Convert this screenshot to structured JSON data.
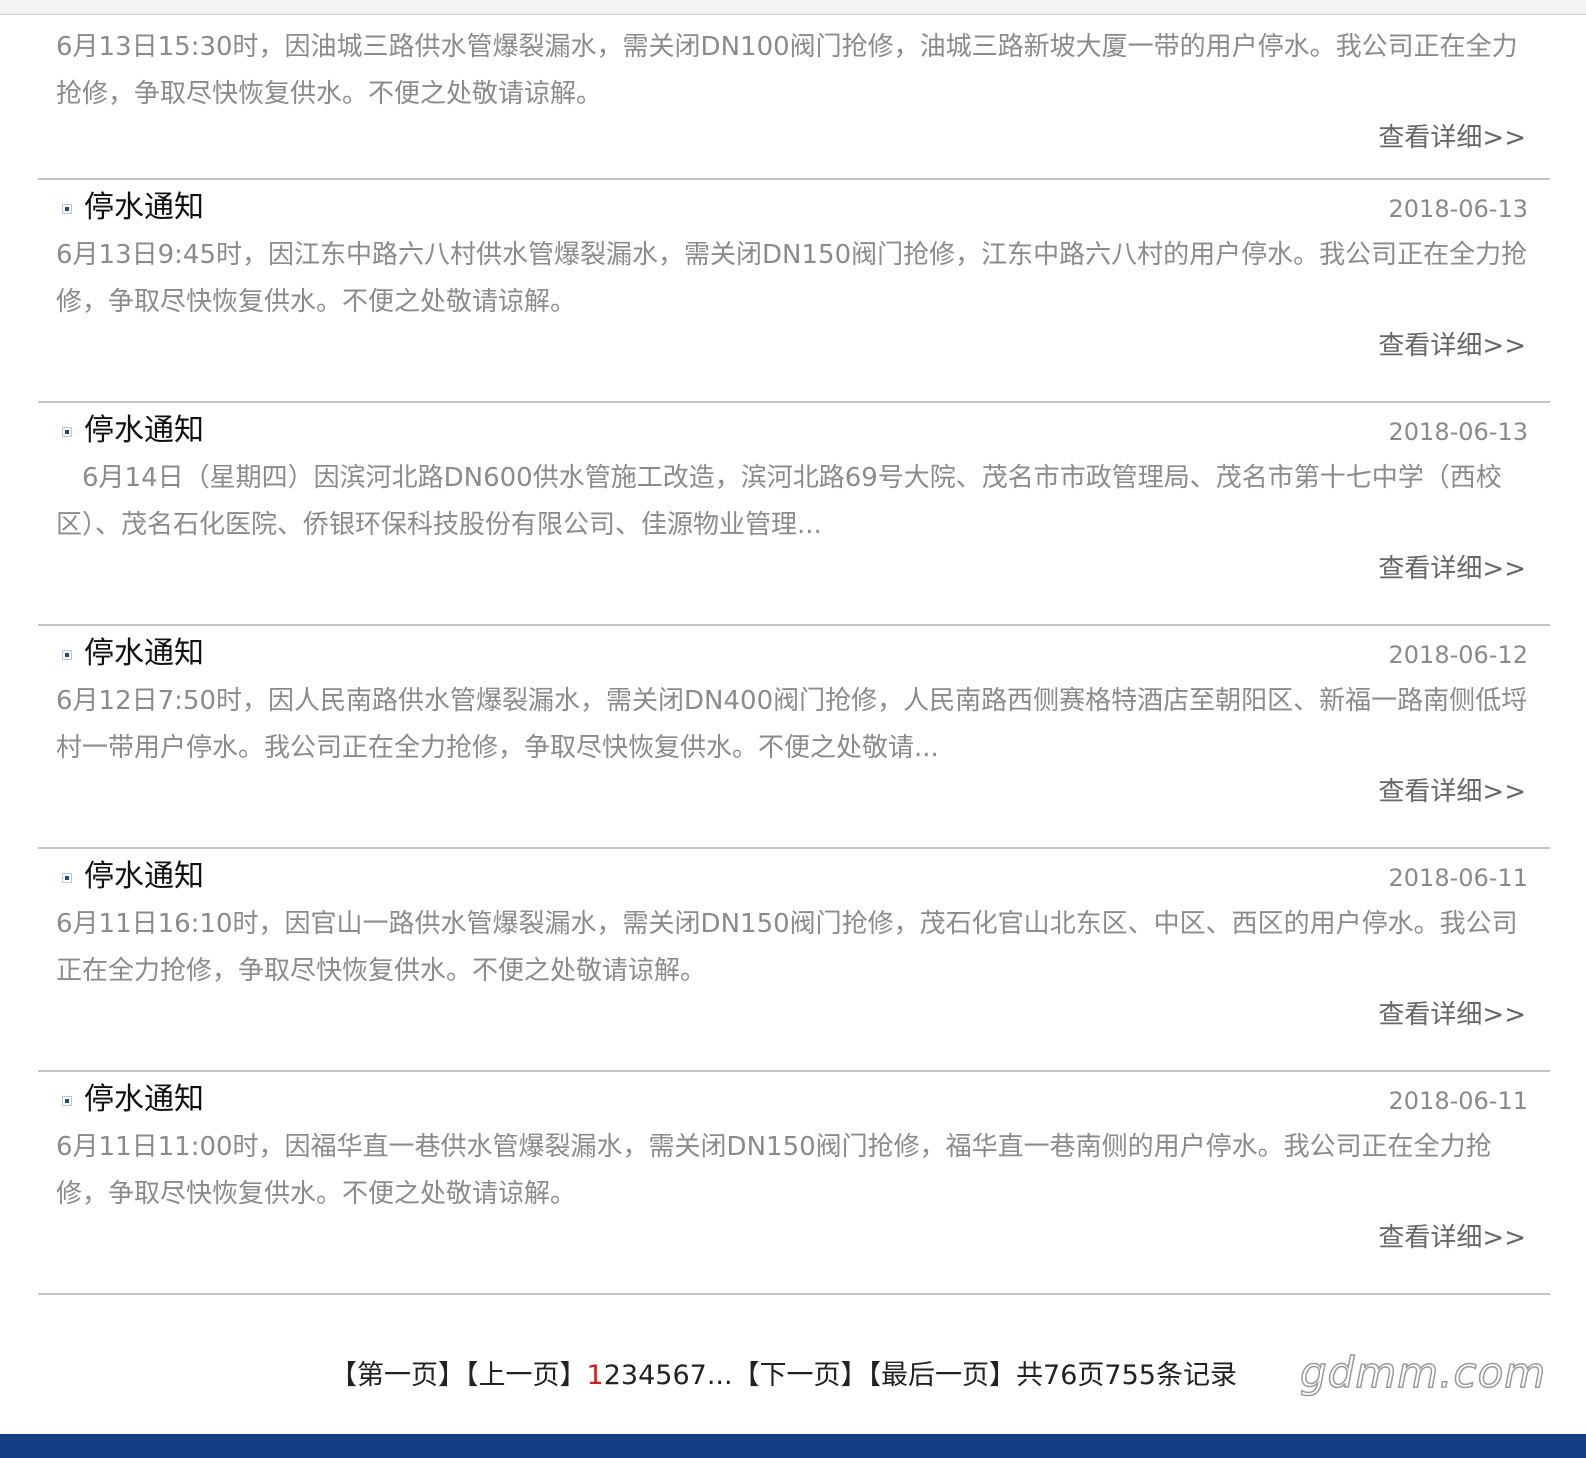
{
  "notices": [
    {
      "title": "",
      "date": "",
      "summary": "6月13日15:30时，因油城三路供水管爆裂漏水，需关闭DN100阀门抢修，油城三路新坡大厦一带的用户停水。我公司正在全力抢修，争取尽快恢复供水。不便之处敬请谅解。",
      "more": "查看详细>>"
    },
    {
      "title": "停水通知",
      "date": "2018-06-13",
      "summary": "6月13日9:45时，因江东中路六八村供水管爆裂漏水，需关闭DN150阀门抢修，江东中路六八村的用户停水。我公司正在全力抢修，争取尽快恢复供水。不便之处敬请谅解。",
      "more": "查看详细>>"
    },
    {
      "title": "停水通知",
      "date": "2018-06-13",
      "summary": "　6月14日（星期四）因滨河北路DN600供水管施工改造，滨河北路69号大院、茂名市市政管理局、茂名市第十七中学（西校区）、茂名石化医院、侨银环保科技股份有限公司、佳源物业管理...",
      "more": "查看详细>>"
    },
    {
      "title": "停水通知",
      "date": "2018-06-12",
      "summary": "6月12日7:50时，因人民南路供水管爆裂漏水，需关闭DN400阀门抢修，人民南路西侧赛格特酒店至朝阳区、新福一路南侧低埒村一带用户停水。我公司正在全力抢修，争取尽快恢复供水。不便之处敬请...",
      "more": "查看详细>>"
    },
    {
      "title": "停水通知",
      "date": "2018-06-11",
      "summary": "6月11日16:10时，因官山一路供水管爆裂漏水，需关闭DN150阀门抢修，茂石化官山北东区、中区、西区的用户停水。我公司正在全力抢修，争取尽快恢复供水。不便之处敬请谅解。",
      "more": "查看详细>>"
    },
    {
      "title": "停水通知",
      "date": "2018-06-11",
      "summary": "6月11日11:00时，因福华直一巷供水管爆裂漏水，需关闭DN150阀门抢修，福华直一巷南侧的用户停水。我公司正在全力抢修，争取尽快恢复供水。不便之处敬请谅解。",
      "more": "查看详细>>"
    }
  ],
  "pager": {
    "first": "【第一页】",
    "prev": "【上一页】",
    "current": "1",
    "pages": [
      "2",
      "3",
      "4",
      "5",
      "6",
      "7"
    ],
    "ellipsis": "...",
    "next": "【下一页】",
    "last": "【最后一页】",
    "summary": "共76页755条记录"
  },
  "watermark": "gdmm.com",
  "colors": {
    "accent": "#123f86",
    "current_page": "#d21f1f",
    "summary_text": "#8b8b8b"
  }
}
